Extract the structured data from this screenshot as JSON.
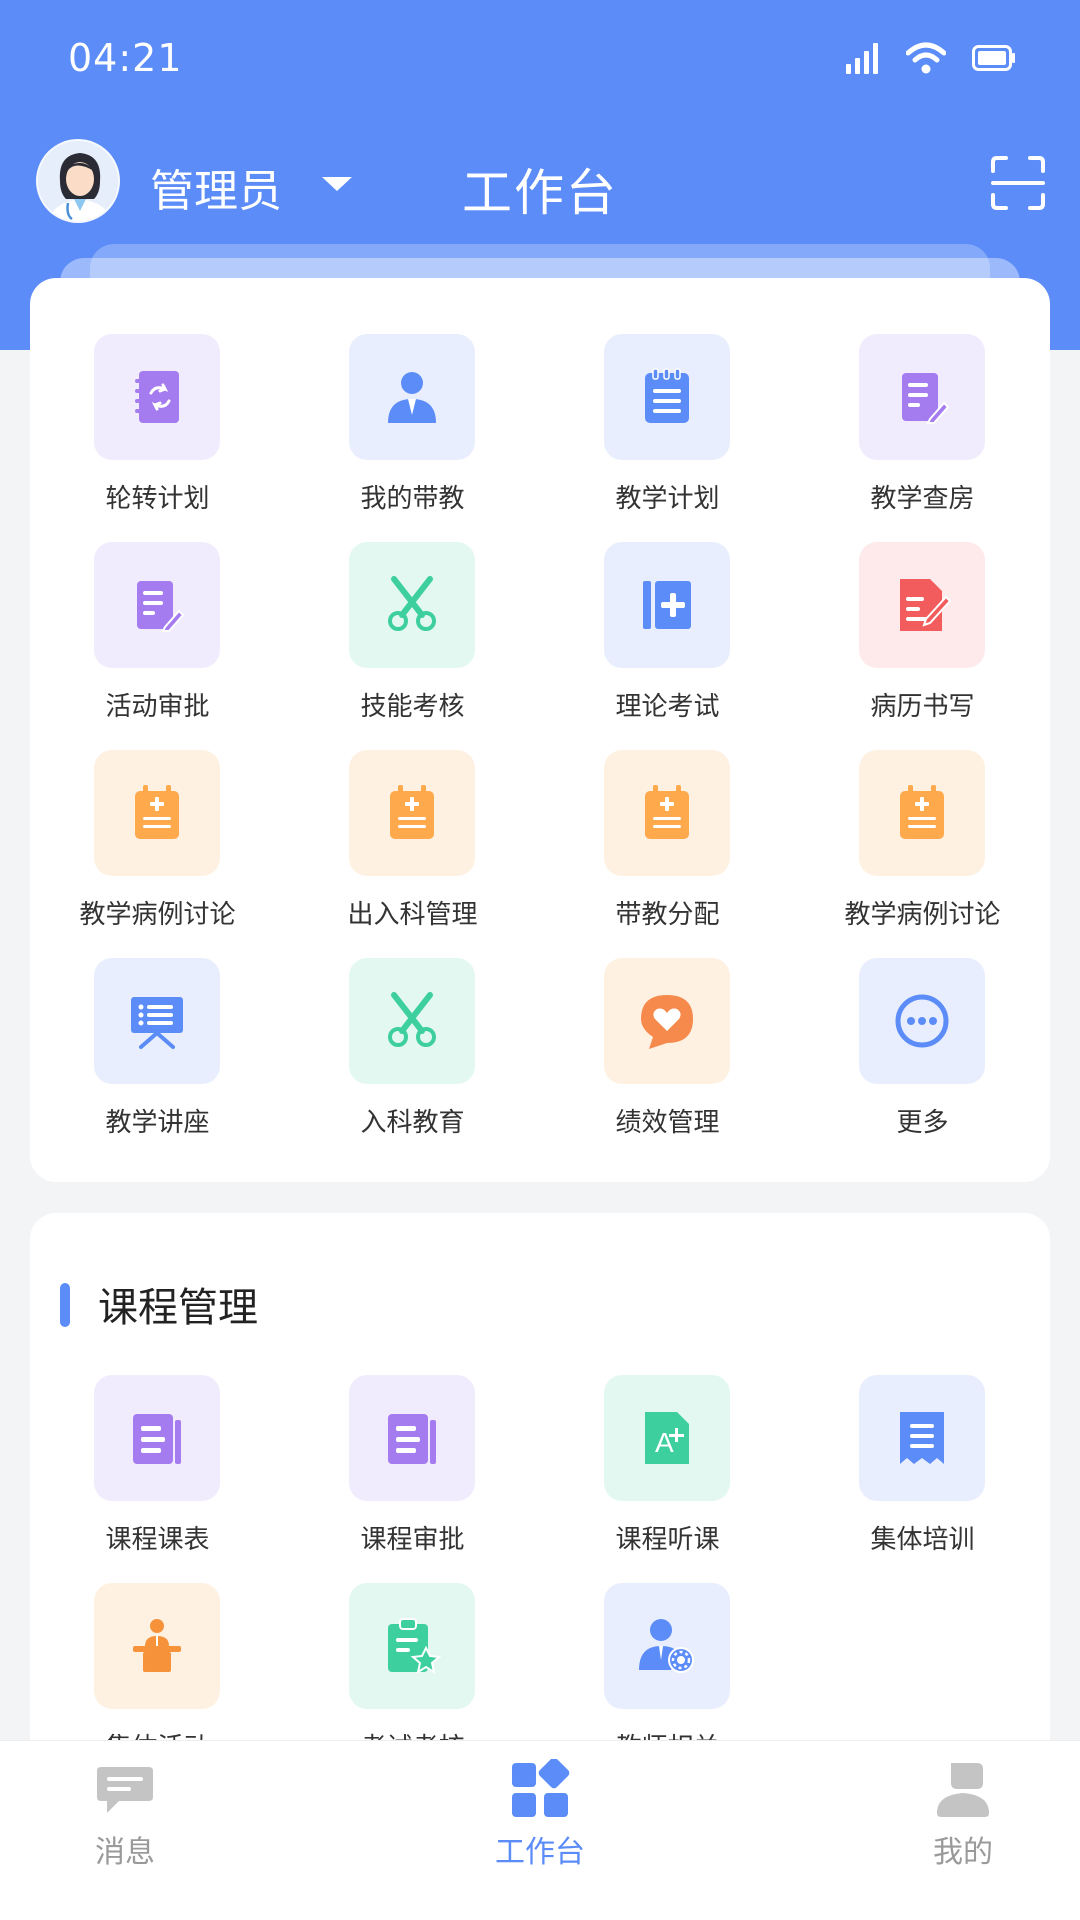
{
  "status_bar": {
    "time": "04:21"
  },
  "header": {
    "role": "管理员",
    "title": "工作台"
  },
  "main_grid": [
    {
      "label": "轮转计划",
      "icon": "notebook-sync-icon",
      "tone": "purple"
    },
    {
      "label": "我的带教",
      "icon": "teacher-person-icon",
      "tone": "blue"
    },
    {
      "label": "教学计划",
      "icon": "notepad-list-icon",
      "tone": "blue"
    },
    {
      "label": "教学查房",
      "icon": "document-edit-icon",
      "tone": "purple"
    },
    {
      "label": "活动审批",
      "icon": "document-edit-icon",
      "tone": "purple"
    },
    {
      "label": "技能考核",
      "icon": "scissors-icon",
      "tone": "green"
    },
    {
      "label": "理论考试",
      "icon": "book-plus-icon",
      "tone": "blue"
    },
    {
      "label": "病历书写",
      "icon": "medical-record-pen-icon",
      "tone": "red"
    },
    {
      "label": "教学病例讨论",
      "icon": "clipboard-medical-icon",
      "tone": "orange"
    },
    {
      "label": "出入科管理",
      "icon": "clipboard-medical-icon",
      "tone": "orange"
    },
    {
      "label": "带教分配",
      "icon": "clipboard-medical-icon",
      "tone": "orange"
    },
    {
      "label": "教学病例讨论",
      "icon": "clipboard-medical-icon",
      "tone": "orange"
    },
    {
      "label": "教学讲座",
      "icon": "presentation-board-icon",
      "tone": "blue"
    },
    {
      "label": "入科教育",
      "icon": "scissors-icon",
      "tone": "green"
    },
    {
      "label": "绩效管理",
      "icon": "heart-chat-icon",
      "tone": "orange"
    },
    {
      "label": "更多",
      "icon": "more-dots-icon",
      "tone": "blue"
    }
  ],
  "course_section": {
    "title": "课程管理",
    "items": [
      {
        "label": "课程课表",
        "icon": "document-lines-icon",
        "tone": "purple"
      },
      {
        "label": "课程审批",
        "icon": "document-lines-icon",
        "tone": "purple"
      },
      {
        "label": "课程听课",
        "icon": "grade-a-plus-icon",
        "tone": "green"
      },
      {
        "label": "集体培训",
        "icon": "receipt-icon",
        "tone": "blue"
      },
      {
        "label": "集体活动",
        "icon": "lecturer-podium-icon",
        "tone": "orange"
      },
      {
        "label": "考试考核",
        "icon": "clipboard-star-icon",
        "tone": "green"
      },
      {
        "label": "教师相关",
        "icon": "user-gear-icon",
        "tone": "blue"
      }
    ]
  },
  "tabbar": [
    {
      "label": "消息",
      "icon": "message-icon",
      "active": false
    },
    {
      "label": "工作台",
      "icon": "workbench-icon",
      "active": true
    },
    {
      "label": "我的",
      "icon": "profile-icon",
      "active": false
    }
  ],
  "colors": {
    "primary": "#5b8cf8",
    "purple": "#a47cf0",
    "green": "#3ecf9e",
    "orange": "#ffa94d",
    "red": "#f25c5c"
  }
}
